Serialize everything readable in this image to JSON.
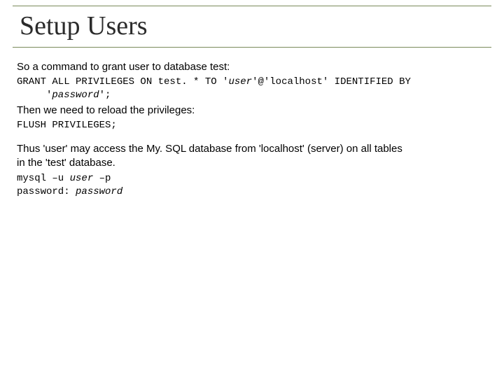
{
  "title": "Setup Users",
  "p1": "So a command to grant user to database test:",
  "code1a_pre": "GRANT ALL PRIVILEGES ON test. * TO '",
  "code1a_user": "user",
  "code1a_post": "'@'localhost' IDENTIFIED BY",
  "code1b_pre": "'",
  "code1b_pass": "password",
  "code1b_post": "';",
  "p2": "Then we need to reload the privileges:",
  "code2": "FLUSH PRIVILEGES;",
  "p3": "Thus 'user' may access the My. SQL database from 'localhost' (server) on all tables in the 'test' database.",
  "code3_pre": "mysql –u ",
  "code3_user": "user",
  "code3_post": " –p",
  "code4_pre": "password: ",
  "code4_pass": "password"
}
